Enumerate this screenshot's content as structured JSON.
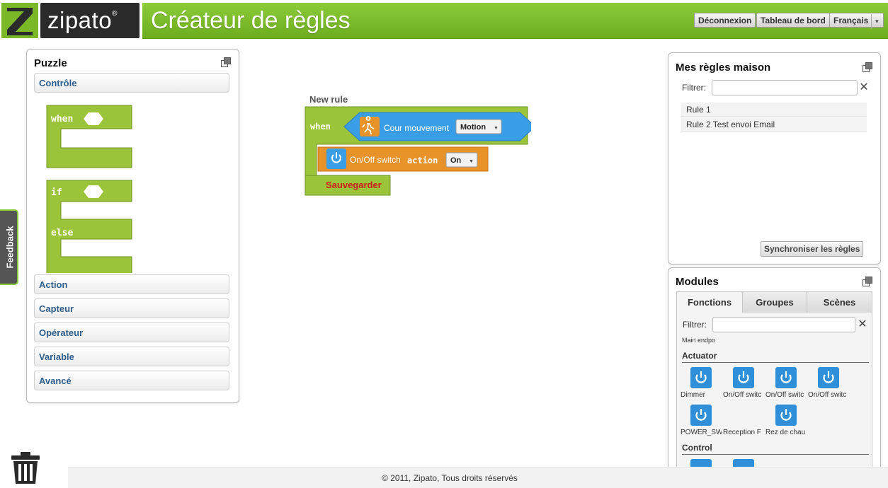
{
  "header": {
    "logo_text": "zipato",
    "logo_reg": "®",
    "title": "Créateur de règles",
    "buttons": {
      "logout": "Déconnexion",
      "dashboard": "Tableau de bord",
      "language": "Français"
    }
  },
  "puzzle": {
    "title": "Puzzle",
    "categories": [
      "Contrôle",
      "Action",
      "Capteur",
      "Opérateur",
      "Variable",
      "Avancé"
    ],
    "blocks": {
      "when": "when",
      "if": "if",
      "else": "else"
    }
  },
  "feedback": "Feedback",
  "rule": {
    "name": "New rule",
    "when": "when",
    "sensor": "Cour mouvement",
    "sensor_state": "Motion",
    "device": "On/Off switch",
    "action_word": "action",
    "action_value": "On",
    "save": "Sauvegarder"
  },
  "my_rules": {
    "title": "Mes règles maison",
    "filter_label": "Filtrer:",
    "items": [
      "Rule 1",
      "Rule 2 Test envoi Email"
    ],
    "sync_button": "Synchroniser les règles"
  },
  "modules": {
    "title": "Modules",
    "tabs": [
      "Fonctions",
      "Groupes",
      "Scènes"
    ],
    "filter_label": "Filtrer:",
    "endpoint_label": "Main endpo",
    "sections": [
      {
        "name": "Actuator",
        "items": [
          "Dimmer",
          "On/Off switc",
          "On/Off switc",
          "On/Off switc",
          "POWER_SW",
          "Reception F",
          "Rez de chau"
        ]
      },
      {
        "name": "Control",
        "items": []
      }
    ]
  },
  "footer": "© 2011, Zipato, Tous droits réservés",
  "colors": {
    "brand_green": "#7ab827",
    "block_green": "#9cc43a",
    "block_blue": "#3a9ee6",
    "block_orange": "#e8922a",
    "save_red": "#cc1a1a"
  }
}
